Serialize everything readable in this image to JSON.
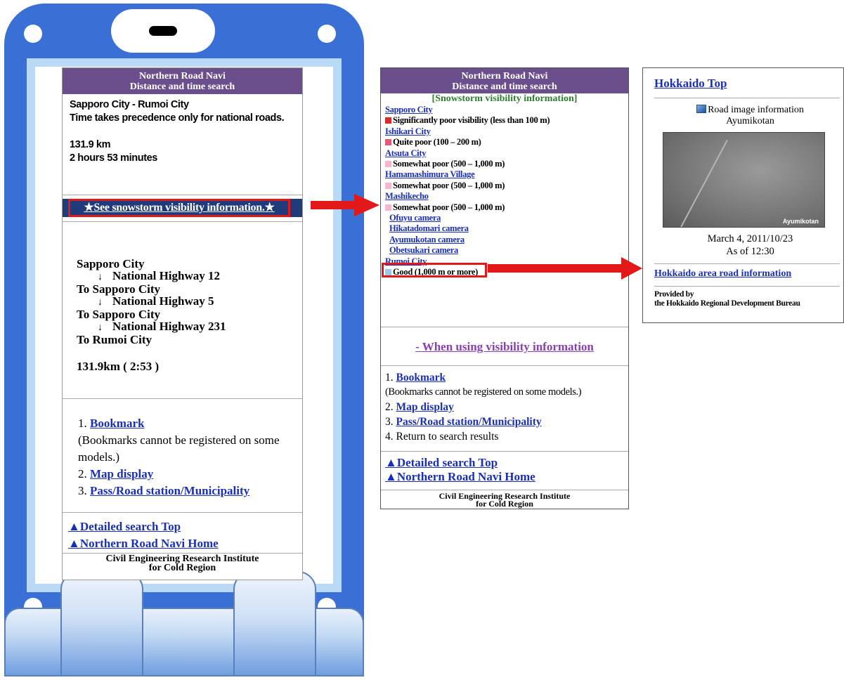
{
  "left_page": {
    "header_line1": "Northern Road Navi",
    "header_line2": "Distance and time search",
    "route_title": "Sapporo City - Rumoi City",
    "priority_note": "Time takes precedence only for national roads.",
    "distance": "131.9 km",
    "duration": "2 hours 53 minutes",
    "snowstorm_link": "★See snowstorm visibility information.★",
    "route": {
      "start": "Sapporo City",
      "arrow": "↓",
      "steps": [
        {
          "highway": "National Highway 12",
          "to": "To Sapporo City"
        },
        {
          "highway": "National Highway 5",
          "to": "To Sapporo City"
        },
        {
          "highway": "National Highway 231",
          "to": "To Rumoi City"
        }
      ]
    },
    "total": "131.9km ( 2:53 )",
    "menu": {
      "item1_num": "1.",
      "item1": "Bookmark",
      "note": "(Bookmarks cannot be registered on some models.)",
      "item2_num": "2.",
      "item2": "Map display",
      "item3_num": "3.",
      "item3": "Pass/Road station/Municipality"
    },
    "detailed_search_top": "▲Detailed search Top",
    "navi_home": "▲Northern Road Navi Home",
    "credit_line1": "Civil Engineering Research Institute",
    "credit_line2": "for Cold Region"
  },
  "middle_page": {
    "header_line1": "Northern Road Navi",
    "header_line2": "Distance and time search",
    "subtitle": "[Snowstorm visibility information]",
    "entries": [
      {
        "city": "Sapporo City",
        "visibility": "Significantly poor visibility (less than 100 m)",
        "color": "#d92b2b"
      },
      {
        "city": "Ishikari City",
        "visibility": "Quite poor (100 – 200 m)",
        "color": "#e35a7a"
      },
      {
        "city": "Atsuta City",
        "visibility": "Somewhat poor (500 – 1,000 m)",
        "color": "#f4b8cc"
      },
      {
        "city": "Hamamashimura Village",
        "visibility": "Somewhat poor (500 – 1,000 m)",
        "color": "#f4b8cc"
      },
      {
        "city": "Mashikecho",
        "visibility": "Somewhat poor (500 – 1,000 m)",
        "color": "#f4b8cc"
      }
    ],
    "cameras": [
      "Ofuyu camera",
      "Hikatadomari camera",
      "Ayumukotan camera",
      "Obetsukari camera"
    ],
    "last_city": "Rumoi City",
    "last_visibility": "Good (1,000 m or more)",
    "last_color": "#9ec8ea",
    "when_using": "- When using visibility information",
    "menu": {
      "item1_num": "1.",
      "item1": "Bookmark",
      "note": "(Bookmarks cannot be registered on some models.)",
      "item2_num": "2.",
      "item2": "Map display",
      "item3_num": "3.",
      "item3": "Pass/Road station/Municipality",
      "item4": "4. Return to search results"
    },
    "detailed_search_top": "▲Detailed search Top",
    "navi_home": "▲Northern Road Navi Home",
    "credit_line1": "Civil Engineering Research Institute",
    "credit_line2": "for Cold Region"
  },
  "right_page": {
    "top_link": "Hokkaido Top",
    "image_title": "Road image information",
    "location": "Ayumikotan",
    "image_caption": "Ayumikotan",
    "date": "March 4, 2011/10/23",
    "time": "As of 12:30",
    "area_link": "Hokkaido area road information",
    "provided_by": "Provided by",
    "provider": "the Hokkaido Regional Development Bureau"
  },
  "colors": {
    "header_purple": "#6b4e8c",
    "link_blue": "#1a2fb8",
    "highlight_red": "#e31919",
    "phone_blue": "#3a6fd6"
  }
}
